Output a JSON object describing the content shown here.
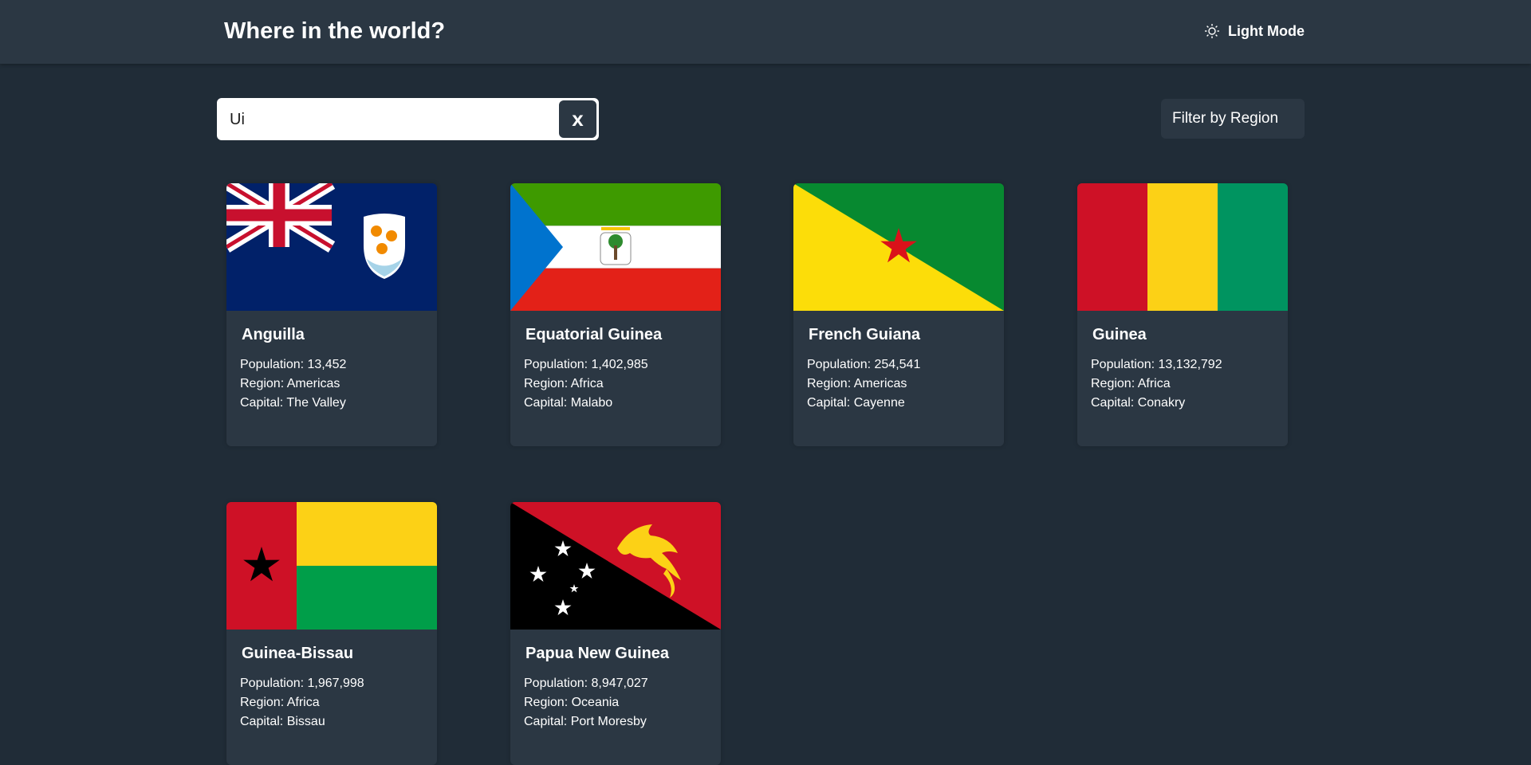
{
  "header": {
    "title": "Where in the world?",
    "mode_label": "Light Mode",
    "mode_icon": "sun-icon"
  },
  "search": {
    "value": "Ui",
    "clear_label": "x"
  },
  "filter": {
    "label": "Filter by Region"
  },
  "countries": [
    {
      "name": "Anguilla",
      "population": "Population: 13,452",
      "region": "Region: Americas",
      "capital": "Capital: The Valley"
    },
    {
      "name": "Equatorial Guinea",
      "population": "Population: 1,402,985",
      "region": "Region: Africa",
      "capital": "Capital: Malabo"
    },
    {
      "name": "French Guiana",
      "population": "Population: 254,541",
      "region": "Region: Americas",
      "capital": "Capital: Cayenne"
    },
    {
      "name": "Guinea",
      "population": "Population: 13,132,792",
      "region": "Region: Africa",
      "capital": "Capital: Conakry"
    },
    {
      "name": "Guinea-Bissau",
      "population": "Population: 1,967,998",
      "region": "Region: Africa",
      "capital": "Capital: Bissau"
    },
    {
      "name": "Papua New Guinea",
      "population": "Population: 8,947,027",
      "region": "Region: Oceania",
      "capital": "Capital: Port Moresby"
    }
  ],
  "colors": {
    "background": "#202c37",
    "elements": "#2b3743",
    "text": "#ffffff"
  }
}
